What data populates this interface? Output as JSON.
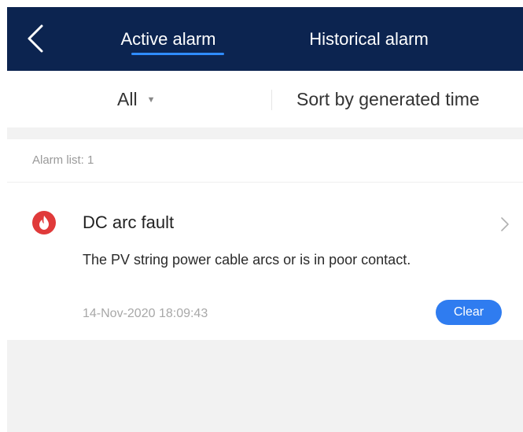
{
  "header": {
    "tabs": [
      {
        "label": "Active alarm",
        "active": true
      },
      {
        "label": "Historical alarm",
        "active": false
      }
    ],
    "back_icon": "chevron-left-icon"
  },
  "filters": {
    "type_selected": "All",
    "sort_label": "Sort by generated time"
  },
  "alarm_list": {
    "header": "Alarm list: 1",
    "items": [
      {
        "icon": "fire-alarm-icon",
        "title": "DC arc fault",
        "description": "The PV string power cable arcs or is in poor contact.",
        "time": "14-Nov-2020 18:09:43",
        "action_label": "Clear"
      }
    ]
  },
  "colors": {
    "header_bg": "#0c2450",
    "accent": "#2f7cf0",
    "alarm_icon": "#e03a3a"
  }
}
